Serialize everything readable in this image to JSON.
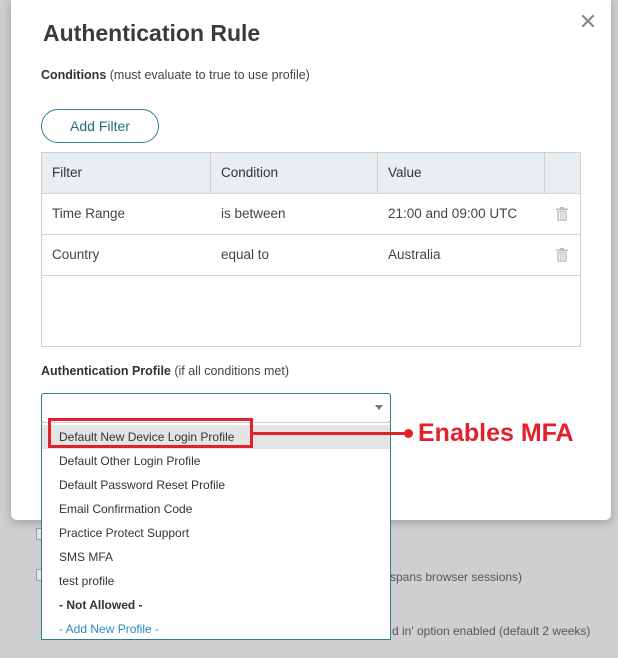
{
  "modal": {
    "title": "Authentication Rule",
    "close_glyph": "✕",
    "conditions_label": "Conditions",
    "conditions_hint": "(must evaluate to true to use profile)",
    "add_filter_label": "Add Filter",
    "table": {
      "headers": [
        "Filter",
        "Condition",
        "Value"
      ],
      "rows": [
        {
          "filter": "Time Range",
          "condition": "is between",
          "value": "21:00 and 09:00 UTC"
        },
        {
          "filter": "Country",
          "condition": "equal to",
          "value": "Australia"
        }
      ]
    },
    "profile_label": "Authentication Profile",
    "profile_hint": "(if all conditions met)",
    "profile_value": ""
  },
  "dropdown": {
    "options": [
      "Default New Device Login Profile",
      "Default Other Login Profile",
      "Default Password Reset Profile",
      "Email Confirmation Code",
      "Practice Protect Support",
      "SMS MFA",
      "test profile",
      "- Not Allowed -",
      "- Add New Profile -"
    ]
  },
  "background": {
    "text_1": "spans browser sessions)",
    "text_2": "d in' option enabled (default 2 weeks)"
  },
  "annotation": {
    "text": "Enables MFA",
    "color": "#e3202b"
  },
  "colors": {
    "accent": "#2a7f8a",
    "link": "#2a8ac4"
  }
}
